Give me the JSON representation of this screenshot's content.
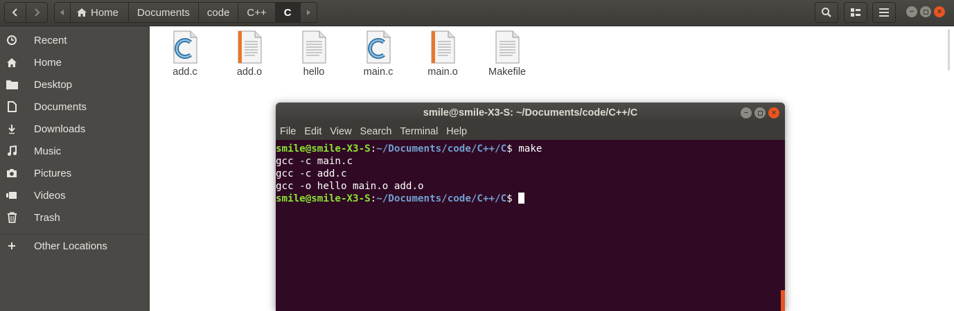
{
  "breadcrumbs": [
    "Home",
    "Documents",
    "code",
    "C++",
    "C"
  ],
  "sidebar": {
    "items": [
      {
        "label": "Recent",
        "icon": "clock-icon"
      },
      {
        "label": "Home",
        "icon": "home-icon"
      },
      {
        "label": "Desktop",
        "icon": "folder-icon"
      },
      {
        "label": "Documents",
        "icon": "document-icon"
      },
      {
        "label": "Downloads",
        "icon": "download-icon"
      },
      {
        "label": "Music",
        "icon": "music-icon"
      },
      {
        "label": "Pictures",
        "icon": "camera-icon"
      },
      {
        "label": "Videos",
        "icon": "video-icon"
      },
      {
        "label": "Trash",
        "icon": "trash-icon"
      },
      {
        "label": "Other Locations",
        "icon": "plus-icon"
      }
    ]
  },
  "files": [
    {
      "name": "add.c",
      "type": "c-source"
    },
    {
      "name": "add.o",
      "type": "object"
    },
    {
      "name": "hello",
      "type": "plain"
    },
    {
      "name": "main.c",
      "type": "c-source"
    },
    {
      "name": "main.o",
      "type": "object"
    },
    {
      "name": "Makefile",
      "type": "plain"
    }
  ],
  "terminal": {
    "title": "smile@smile-X3-S: ~/Documents/code/C++/C",
    "menu": [
      "File",
      "Edit",
      "View",
      "Search",
      "Terminal",
      "Help"
    ],
    "prompt_user": "smile@smile-X3-S",
    "prompt_sep": ":",
    "prompt_path": "~/Documents/code/C++/C",
    "prompt_dollar": "$ ",
    "command": "make",
    "output": [
      "gcc -c main.c",
      "gcc -c add.c",
      "gcc -o hello main.o add.o"
    ]
  },
  "colors": {
    "terminal_bg": "#300a24",
    "prompt_user": "#8ae234",
    "prompt_path": "#729fcf",
    "close_button": "#e95420"
  }
}
